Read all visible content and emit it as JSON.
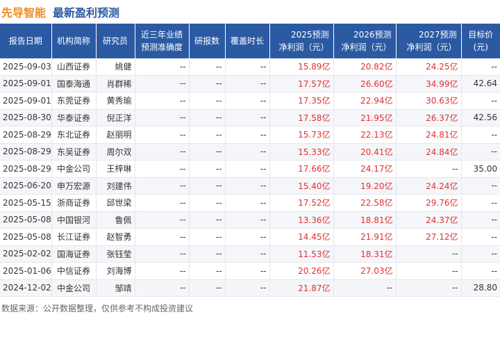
{
  "title": {
    "company": "先导智能",
    "subtitle": "最新盈利预测"
  },
  "headers": {
    "date": "报告日期",
    "org": "机构简称",
    "analyst": "研究员",
    "accuracy_l1": "近三年业绩",
    "accuracy_l2": "预测准确度",
    "reports": "研报数",
    "coverage": "覆盖时长",
    "y2025_l1": "2025预测",
    "y2025_l2": "净利润（元）",
    "y2026_l1": "2026预测",
    "y2026_l2": "净利润（元）",
    "y2027_l1": "2027预测",
    "y2027_l2": "净利润（元）",
    "target_l1": "目标价",
    "target_l2": "(元)"
  },
  "rows": [
    {
      "date": "2025-09-03",
      "org": "山西证券",
      "analyst": "姚健",
      "accuracy": "--",
      "reports": "--",
      "coverage": "--",
      "p2025": "15.89亿",
      "p2026": "20.82亿",
      "p2027": "24.25亿",
      "target": "--"
    },
    {
      "date": "2025-09-01",
      "org": "国泰海通",
      "analyst": "肖群稀",
      "accuracy": "--",
      "reports": "--",
      "coverage": "--",
      "p2025": "17.57亿",
      "p2026": "26.60亿",
      "p2027": "34.99亿",
      "target": "42.64"
    },
    {
      "date": "2025-09-01",
      "org": "东莞证券",
      "analyst": "黄秀瑜",
      "accuracy": "--",
      "reports": "--",
      "coverage": "--",
      "p2025": "17.35亿",
      "p2026": "22.94亿",
      "p2027": "30.63亿",
      "target": "--"
    },
    {
      "date": "2025-08-30",
      "org": "华泰证券",
      "analyst": "倪正洋",
      "accuracy": "--",
      "reports": "--",
      "coverage": "--",
      "p2025": "17.58亿",
      "p2026": "21.95亿",
      "p2027": "26.37亿",
      "target": "42.56"
    },
    {
      "date": "2025-08-29",
      "org": "东北证券",
      "analyst": "赵丽明",
      "accuracy": "--",
      "reports": "--",
      "coverage": "--",
      "p2025": "15.73亿",
      "p2026": "22.13亿",
      "p2027": "24.81亿",
      "target": "--"
    },
    {
      "date": "2025-08-29",
      "org": "东吴证券",
      "analyst": "周尔双",
      "accuracy": "--",
      "reports": "--",
      "coverage": "--",
      "p2025": "15.33亿",
      "p2026": "20.41亿",
      "p2027": "24.84亿",
      "target": "--"
    },
    {
      "date": "2025-08-29",
      "org": "中金公司",
      "analyst": "王梓琳",
      "accuracy": "--",
      "reports": "--",
      "coverage": "--",
      "p2025": "17.66亿",
      "p2026": "24.17亿",
      "p2027": "--",
      "target": "35.00"
    },
    {
      "date": "2025-06-20",
      "org": "申万宏源",
      "analyst": "刘建伟",
      "accuracy": "--",
      "reports": "--",
      "coverage": "--",
      "p2025": "15.40亿",
      "p2026": "19.20亿",
      "p2027": "24.24亿",
      "target": "--"
    },
    {
      "date": "2025-05-15",
      "org": "浙商证券",
      "analyst": "邱世梁",
      "accuracy": "--",
      "reports": "--",
      "coverage": "--",
      "p2025": "17.52亿",
      "p2026": "22.58亿",
      "p2027": "29.76亿",
      "target": "--"
    },
    {
      "date": "2025-05-08",
      "org": "中国银河",
      "analyst": "鲁佩",
      "accuracy": "--",
      "reports": "--",
      "coverage": "--",
      "p2025": "13.36亿",
      "p2026": "18.81亿",
      "p2027": "24.37亿",
      "target": "--"
    },
    {
      "date": "2025-05-08",
      "org": "长江证券",
      "analyst": "赵智勇",
      "accuracy": "--",
      "reports": "--",
      "coverage": "--",
      "p2025": "14.45亿",
      "p2026": "21.91亿",
      "p2027": "27.12亿",
      "target": "--"
    },
    {
      "date": "2025-02-02",
      "org": "国海证券",
      "analyst": "张钰莹",
      "accuracy": "--",
      "reports": "--",
      "coverage": "--",
      "p2025": "11.53亿",
      "p2026": "18.31亿",
      "p2027": "--",
      "target": "--"
    },
    {
      "date": "2025-01-06",
      "org": "中信证券",
      "analyst": "刘海博",
      "accuracy": "--",
      "reports": "--",
      "coverage": "--",
      "p2025": "20.26亿",
      "p2026": "27.03亿",
      "p2027": "--",
      "target": "--"
    },
    {
      "date": "2024-12-02",
      "org": "中金公司",
      "analyst": "邹靖",
      "accuracy": "--",
      "reports": "--",
      "coverage": "--",
      "p2025": "21.87亿",
      "p2026": "--",
      "p2027": "--",
      "target": "28.80"
    }
  ],
  "footer": "数据来源：公开数据整理，仅供参考不构成投资建议",
  "colors": {
    "header_bg": "#2b5aa3",
    "company": "#f08a1e",
    "subtitle": "#2b5aa3",
    "value_red": "#e03030"
  }
}
